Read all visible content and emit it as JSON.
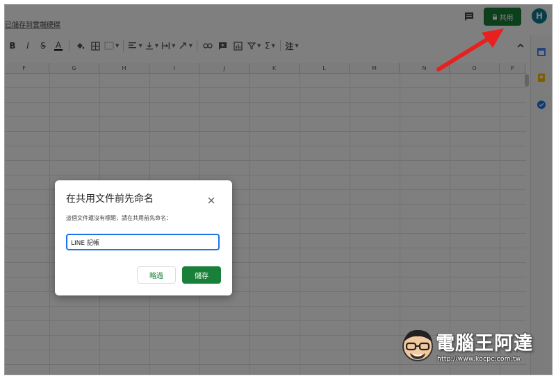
{
  "app": {
    "saved_status": "已儲存到雲端硬碟",
    "share_label": "共用",
    "avatar_letter": "H"
  },
  "toolbar": {
    "items": [
      "B",
      "I",
      "S",
      "A",
      "fill-color",
      "borders",
      "merge",
      "align-h",
      "align-v",
      "wrap",
      "rotate",
      "link",
      "comment",
      "chart",
      "filter",
      "functions",
      "input-tools"
    ],
    "sum_label": "Σ",
    "input_tool_label": "注"
  },
  "columns": [
    "F",
    "G",
    "H",
    "I",
    "J",
    "K",
    "L",
    "M",
    "N",
    "O",
    "P"
  ],
  "dialog": {
    "title": "在共用文件前先命名",
    "description": "這個文件還沒有標題，請在共用前先命名：",
    "input_value": "LINE 記帳",
    "skip_label": "略過",
    "save_label": "儲存"
  },
  "watermark": {
    "title": "電腦王阿達",
    "url": "http://www.kocpc.com.tw"
  },
  "colors": {
    "accent_green": "#188038",
    "focus_blue": "#1a73e8",
    "annotation_red": "#e8211f"
  }
}
